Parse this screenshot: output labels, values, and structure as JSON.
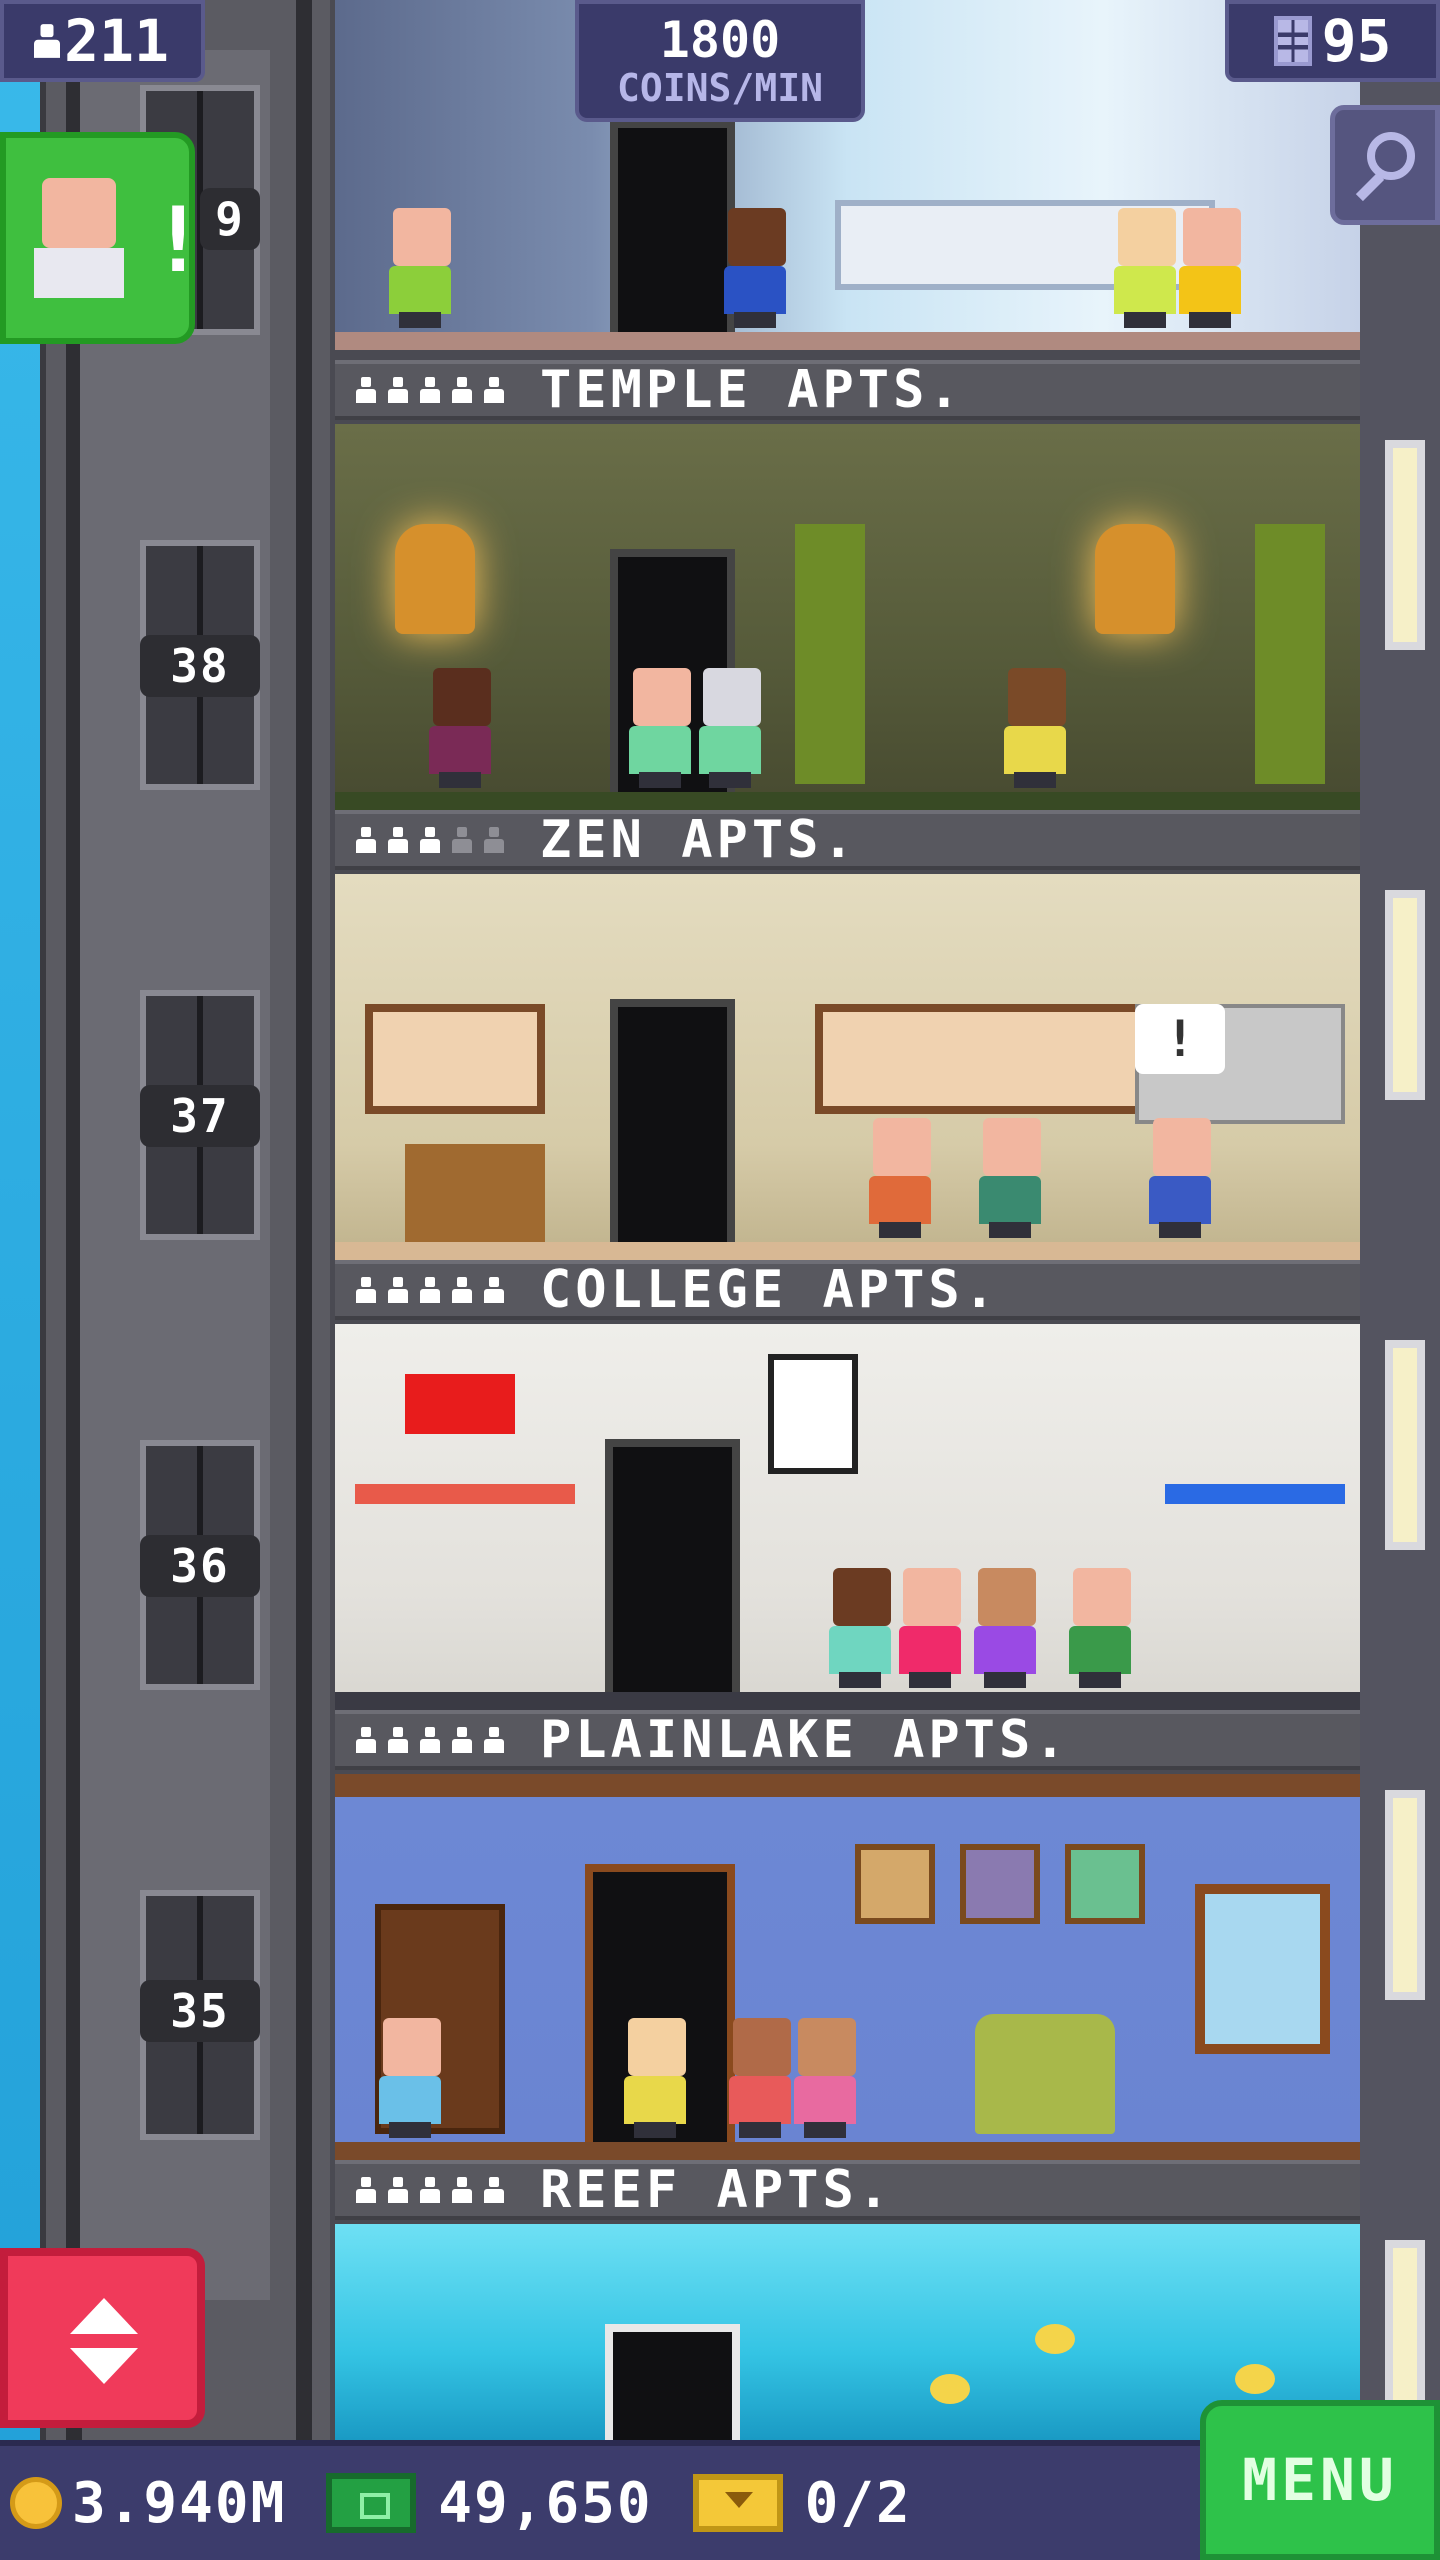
{
  "hud": {
    "population": "211",
    "coins_per_min_value": "1800",
    "coins_per_min_label": "COINS/MIN",
    "floors": "95"
  },
  "elevator": {
    "floor_numbers": [
      "9",
      "38",
      "37",
      "36",
      "35"
    ]
  },
  "floors": [
    {
      "name": "TEMPLE APTS.",
      "stars_filled": 5,
      "stars_total": 5
    },
    {
      "name": "ZEN APTS.",
      "stars_filled": 3,
      "stars_total": 5
    },
    {
      "name": "COLLEGE APTS.",
      "stars_filled": 5,
      "stars_total": 5
    },
    {
      "name": "PLAINLAKE APTS.",
      "stars_filled": 5,
      "stars_total": 5
    },
    {
      "name": "REEF APTS.",
      "stars_filled": 5,
      "stars_total": 5
    }
  ],
  "speech_bubble": "!",
  "bottom_bar": {
    "coins": "3.940M",
    "bux": "49,650",
    "tickets": "0/2",
    "menu_label": "MENU"
  },
  "icons": [
    "person-icon",
    "building-icon",
    "zoom-icon",
    "visitor-alert-icon",
    "elevator-arrows-icon",
    "coin-icon",
    "bux-icon",
    "ticket-icon"
  ],
  "colors": {
    "sky": "#2aa9df",
    "hud": "#3a3a6a",
    "menu": "#2ec24a",
    "elevator_button": "#f03a5a",
    "visitor_button": "#3fbf3f"
  }
}
